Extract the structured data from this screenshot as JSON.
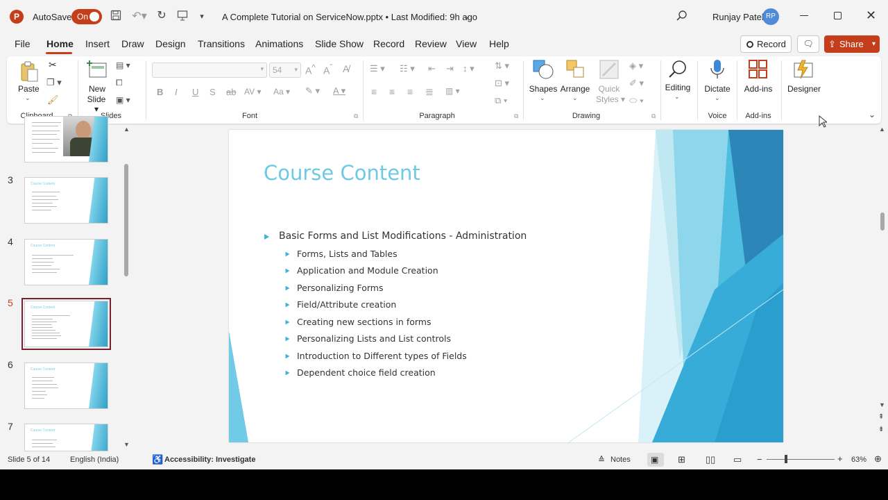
{
  "titlebar": {
    "app_logo": "P",
    "autosave_label": "AutoSave",
    "autosave_state": "On",
    "doc_title": "A Complete Tutorial on ServiceNow.pptx • Last Modified: 9h ago",
    "user_name": "Runjay Patel",
    "user_initials": "RP"
  },
  "tabs": [
    "File",
    "Home",
    "Insert",
    "Draw",
    "Design",
    "Transitions",
    "Animations",
    "Slide Show",
    "Record",
    "Review",
    "View",
    "Help"
  ],
  "active_tab": "Home",
  "actions": {
    "record": "Record",
    "share": "Share"
  },
  "ribbon": {
    "clipboard": {
      "label": "Clipboard",
      "paste": "Paste"
    },
    "slides": {
      "label": "Slides",
      "new_slide_1": "New",
      "new_slide_2": "Slide"
    },
    "font": {
      "label": "Font",
      "size": "54"
    },
    "paragraph": {
      "label": "Paragraph"
    },
    "drawing": {
      "label": "Drawing",
      "shapes": "Shapes",
      "arrange": "Arrange",
      "quick_styles_1": "Quick",
      "quick_styles_2": "Styles"
    },
    "editing": {
      "label": "Editing"
    },
    "voice": {
      "label": "Voice",
      "dictate": "Dictate"
    },
    "addins": {
      "label": "Add-ins",
      "addins_btn": "Add-ins"
    },
    "designer": {
      "label": "Designer"
    }
  },
  "thumbnails": [
    {
      "num": "",
      "title": ""
    },
    {
      "num": "3",
      "title": "Course Content"
    },
    {
      "num": "4",
      "title": "Course Content"
    },
    {
      "num": "5",
      "title": "Course Content",
      "selected": true
    },
    {
      "num": "6",
      "title": "Course Content"
    },
    {
      "num": "7",
      "title": "Course Content"
    }
  ],
  "slide": {
    "title": "Course Content",
    "main_bullet": "Basic Forms and List Modifications - Administration",
    "sub_bullets": [
      "Forms, Lists and Tables",
      "Application and Module Creation",
      "Personalizing Forms",
      "Field/Attribute creation",
      "Creating new sections in forms",
      "Personalizing Lists and List controls",
      "Introduction to Different types of Fields",
      "Dependent choice field creation"
    ]
  },
  "status": {
    "slide_info": "Slide 5 of 14",
    "language": "English (India)",
    "accessibility": "Accessibility: Investigate",
    "notes": "Notes",
    "zoom": "63%"
  },
  "colors": {
    "accent": "#c43e1c",
    "title_blue": "#6ec9e2",
    "selected_thumb": "#7a1f2f"
  }
}
